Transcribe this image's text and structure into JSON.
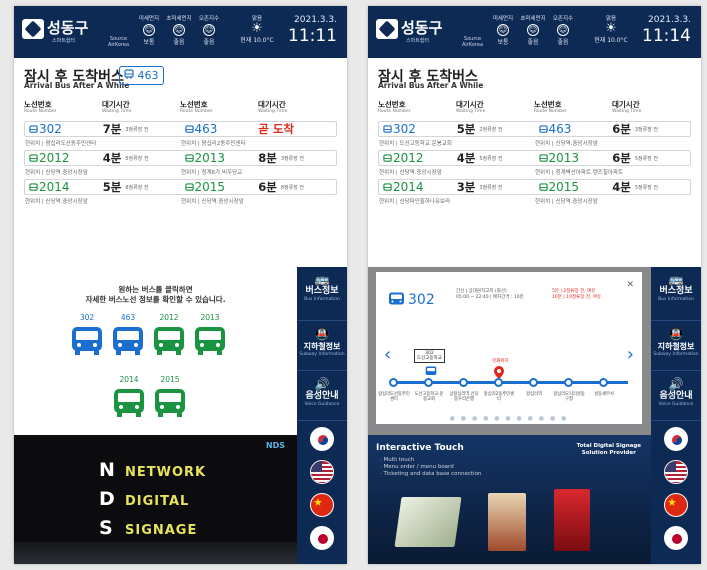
{
  "header": {
    "brand": "성동구",
    "brand_sub": "스마트쉼터",
    "source_label": [
      "Source",
      "AirKorea"
    ],
    "air": [
      {
        "label": "미세먼지",
        "level": "보통"
      },
      {
        "label": "초미세먼지",
        "level": "좋음"
      },
      {
        "label": "오존지수",
        "level": "좋음"
      }
    ],
    "weather": {
      "label": "맑음",
      "temp": "현재 10.0°C"
    }
  },
  "screen_a": {
    "date": "2021.3.3.",
    "time": "11:11",
    "title": "잠시 후 도착버스",
    "title_en": "Arrival Bus After A While",
    "badge": "463",
    "headers": [
      {
        "label": "노선번호",
        "sub": "Route Number"
      },
      {
        "label": "대기시간",
        "sub": "Waiting Time"
      },
      {
        "label": "노선번호",
        "sub": "Route Number"
      },
      {
        "label": "대기시간",
        "sub": "Waiting Time"
      }
    ],
    "rows": [
      {
        "l": {
          "route": "302",
          "wait": "7분",
          "stops": "3정류장 전",
          "current": "현위치 | 왕십리도선동주민센터"
        },
        "r": {
          "route": "463",
          "wait": "곧 도착",
          "stops": "",
          "current": "현위치 | 왕십리2동주민센터"
        }
      },
      {
        "l": {
          "route": "2012",
          "wait": "4분",
          "stops": "5정류장 전",
          "current": "현위치 | 신당역.중앙시장앞"
        },
        "r": {
          "route": "2013",
          "wait": "8분",
          "stops": "3정류장 전",
          "current": "현위치 | 청계6가.비우당교"
        }
      },
      {
        "l": {
          "route": "2014",
          "wait": "5분",
          "stops": "8정류장 전",
          "current": "현위치 | 신당역.중앙시장앞"
        },
        "r": {
          "route": "2015",
          "wait": "6분",
          "stops": "8정류장 전",
          "current": "현위치 | 신당역.중앙시장앞"
        }
      }
    ],
    "panel_msg": [
      "원하는 버스를 클릭하면",
      "자세한 버스노선 정보를 확인할 수 있습니다."
    ],
    "buses": [
      "302",
      "463",
      "2012",
      "2013",
      "2014",
      "2015"
    ],
    "nds": [
      {
        "big": "N",
        "word": "NETWORK"
      },
      {
        "big": "D",
        "word": "DIGITAL"
      },
      {
        "big": "S",
        "word": "SIGNAGE"
      }
    ],
    "nds_logo": "NDS"
  },
  "screen_b": {
    "date": "2021.3.3.",
    "time": "11:14",
    "title": "잠시 후 도착버스",
    "title_en": "Arrival Bus After A While",
    "headers": [
      {
        "label": "노선번호",
        "sub": "Route Number"
      },
      {
        "label": "대기시간",
        "sub": "Waiting Time"
      },
      {
        "label": "노선번호",
        "sub": "Route Number"
      },
      {
        "label": "대기시간",
        "sub": "Waiting Time"
      }
    ],
    "rows": [
      {
        "l": {
          "route": "302",
          "wait": "5분",
          "stops": "2정류장 전",
          "current": "현위치 | 도선고등학교.운봉교회"
        },
        "r": {
          "route": "463",
          "wait": "6분",
          "stops": "3정류장 전",
          "current": "현위치 | 신당역.중앙시장앞"
        }
      },
      {
        "l": {
          "route": "2012",
          "wait": "4분",
          "stops": "5정류장 전",
          "current": "현위치 | 신당역.중앙시장앞"
        },
        "r": {
          "route": "2013",
          "wait": "6분",
          "stops": "5정류장 전",
          "current": "현위치 | 청계벽산아파트.텐즈힐아파트"
        }
      },
      {
        "l": {
          "route": "2014",
          "wait": "3분",
          "stops": "3정류장 전",
          "current": "현위치 | 신당파인힐하나유보라"
        },
        "r": {
          "route": "2015",
          "wait": "4분",
          "stops": "5정류장 전",
          "current": "현위치 | 신당역.중앙시장앞"
        }
      }
    ],
    "popup": {
      "route": "302",
      "info": [
        "간선 | 상대원차고지 (회산)",
        "05:00 ~ 22:40 | 배차간격 : 10분"
      ],
      "info2": [
        "5분 | 2정류장 전, 여유",
        "10분 | 10정류장 전, 여유"
      ],
      "bus_label": [
        "302",
        "도선고등학교"
      ],
      "here_label": "현재위치",
      "stations": [
        "왕십리도선동주민센터",
        "도선고등학교.운봉교회",
        "상왕십리역.신당동우리은행",
        "왕십리2동주민센터",
        "왕십리역",
        "왕십리오거리성동구청",
        "성동세무서"
      ]
    },
    "promo": {
      "title": "Interactive Touch",
      "bullets": [
        "· Multi touch",
        "· Menu order / menu board",
        "· Ticketing and data base connection"
      ],
      "right": [
        "Total Digital Signage",
        "Solution Provider"
      ]
    }
  },
  "rail": [
    {
      "icon": "bus-icon",
      "label": "버스정보",
      "sub": "Bus Information"
    },
    {
      "icon": "subway-icon",
      "label": "지하철정보",
      "sub": "Subway Information"
    },
    {
      "icon": "voice-icon",
      "label": "음성안내",
      "sub": "Voice Guidance"
    }
  ],
  "flags": [
    "korea-flag-icon",
    "usa-flag-icon",
    "china-flag-icon",
    "japan-flag-icon"
  ],
  "colors": {
    "navy": "#0d2a55",
    "blue_bus": "#1a6fce",
    "green_bus": "#1a9441",
    "arriving": "#e0271b"
  }
}
